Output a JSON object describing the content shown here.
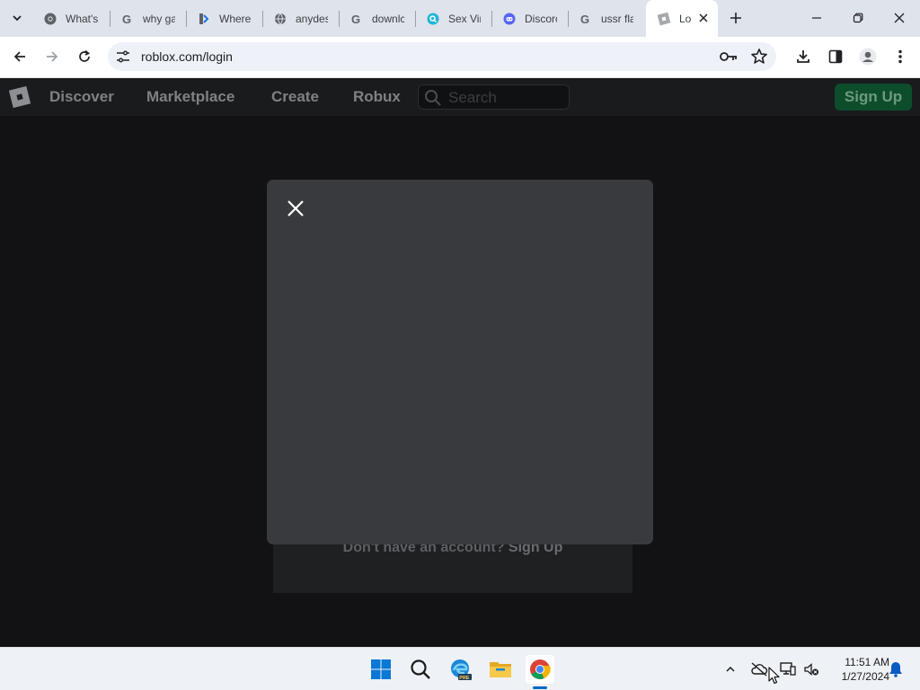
{
  "browser": {
    "tabs": [
      {
        "title": "What's",
        "icon": "chrome-icon"
      },
      {
        "title": "why ga",
        "icon": "google-icon"
      },
      {
        "title": "Where",
        "icon": "site-icon"
      },
      {
        "title": "anydes",
        "icon": "globe-icon"
      },
      {
        "title": "downlc",
        "icon": "google-icon"
      },
      {
        "title": "Sex Vir",
        "icon": "search-site-icon"
      },
      {
        "title": "Discorc",
        "icon": "discord-icon"
      },
      {
        "title": "ussr fla",
        "icon": "google-icon"
      },
      {
        "title": "Lo",
        "icon": "roblox-tab-icon",
        "active": true
      }
    ],
    "url": "roblox.com/login"
  },
  "roblox": {
    "nav": {
      "discover": "Discover",
      "marketplace": "Marketplace",
      "create": "Create",
      "robux": "Robux"
    },
    "search_placeholder": "Search",
    "signup_button": "Sign Up",
    "no_account_text": "Don't have an account?",
    "no_account_link": "Sign Up"
  },
  "taskbar": {
    "apps": [
      "start-icon",
      "search-icon",
      "edge-beta-icon",
      "file-explorer-icon",
      "chrome-icon"
    ],
    "time": "11:51 AM",
    "date": "1/27/2024"
  },
  "colors": {
    "roblox_header": "#191b1d",
    "modal": "#393a3d",
    "signup_green": "#0e4d2c",
    "page_bg": "#121215"
  }
}
